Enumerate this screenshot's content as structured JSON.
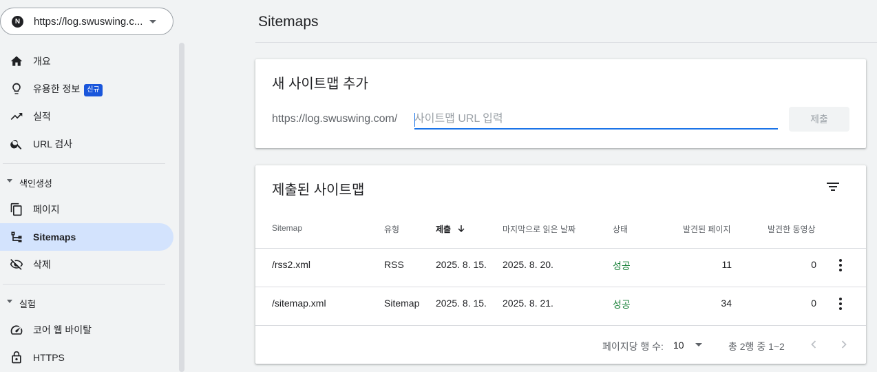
{
  "property": {
    "url": "https://log.swuswing.c...",
    "logo_letter": "N"
  },
  "sidebar": {
    "items": [
      {
        "label": "개요",
        "icon": "home-icon"
      },
      {
        "label": "유용한 정보",
        "icon": "lightbulb-icon",
        "badge": "신규"
      },
      {
        "label": "실적",
        "icon": "trending-up-icon"
      },
      {
        "label": "URL 검사",
        "icon": "search-icon"
      }
    ],
    "section_indexing": "색인생성",
    "indexing_items": [
      {
        "label": "페이지",
        "icon": "pages-icon"
      },
      {
        "label": "Sitemaps",
        "icon": "sitemap-icon",
        "active": true
      },
      {
        "label": "삭제",
        "icon": "visibility-off-icon"
      }
    ],
    "section_experiments": "실험",
    "experiment_items": [
      {
        "label": "코어 웹 바이탈",
        "icon": "speed-icon"
      },
      {
        "label": "HTTPS",
        "icon": "lock-icon"
      }
    ]
  },
  "page": {
    "title": "Sitemaps"
  },
  "add_sitemap": {
    "title": "새 사이트맵 추가",
    "prefix": "https://log.swuswing.com/",
    "placeholder": "사이트맵 URL 입력",
    "value": "",
    "submit_label": "제출"
  },
  "submitted": {
    "title": "제출된 사이트맵",
    "columns": [
      "Sitemap",
      "유형",
      "제출",
      "마지막으로 읽은 날짜",
      "상태",
      "발견된 페이지",
      "발견한 동영상"
    ],
    "sorted_column": "제출",
    "rows": [
      {
        "sitemap": "/rss2.xml",
        "type": "RSS",
        "submitted": "2025. 8. 15.",
        "last_read": "2025. 8. 20.",
        "status": "성공",
        "pages": "11",
        "videos": "0"
      },
      {
        "sitemap": "/sitemap.xml",
        "type": "Sitemap",
        "submitted": "2025. 8. 15.",
        "last_read": "2025. 8. 21.",
        "status": "성공",
        "pages": "34",
        "videos": "0"
      }
    ],
    "footer": {
      "rows_per_page_label": "페이지당 행 수:",
      "rows_per_page": "10",
      "range": "총 2행 중 1~2"
    }
  },
  "colors": {
    "accent": "#1a73e8",
    "active_nav": "#d3e3fd",
    "success": "#188038",
    "badge": "#1a56db"
  }
}
